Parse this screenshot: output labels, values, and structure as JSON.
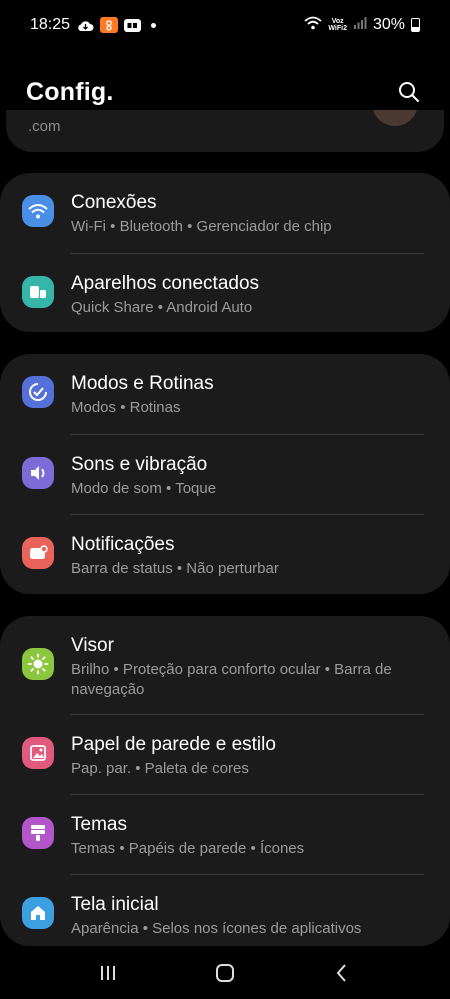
{
  "status_bar": {
    "time": "18:25",
    "voz_line1": "Voz",
    "voz_line2": "WiFi2",
    "battery": "30%",
    "icons": [
      "cloud-icon",
      "orange-app-icon",
      "box-app-icon",
      "notification-dot-icon",
      "wifi-icon",
      "signal-icon",
      "battery-icon"
    ]
  },
  "header": {
    "title": "Config.",
    "search_icon": "search-icon"
  },
  "account": {
    "email_fragment": ".com"
  },
  "groups": [
    {
      "items": [
        {
          "title": "Conexões",
          "subtitle": "Wi-Fi  •  Bluetooth  •  Gerenciador de chip",
          "icon": "wifi-icon",
          "color": "#4a8fe6"
        },
        {
          "title": "Aparelhos conectados",
          "subtitle": "Quick Share  •  Android Auto",
          "icon": "devices-icon",
          "color": "#35b6a8"
        }
      ]
    },
    {
      "items": [
        {
          "title": "Modos e Rotinas",
          "subtitle": "Modos  •  Rotinas",
          "icon": "modes-icon",
          "color": "#5570d8"
        },
        {
          "title": "Sons e vibração",
          "subtitle": "Modo de som  •  Toque",
          "icon": "sound-icon",
          "color": "#7d6bd8"
        },
        {
          "title": "Notificações",
          "subtitle": "Barra de status  •  Não perturbar",
          "icon": "notification-icon",
          "color": "#e8645a"
        }
      ]
    },
    {
      "items": [
        {
          "title": "Visor",
          "subtitle": "Brilho  •  Proteção para conforto ocular  •  Barra de navegação",
          "icon": "brightness-icon",
          "color": "#8cc63f"
        },
        {
          "title": "Papel de parede e estilo",
          "subtitle": "Pap. par.  •  Paleta de cores",
          "icon": "wallpaper-icon",
          "color": "#e05a7e"
        },
        {
          "title": "Temas",
          "subtitle": "Temas  •  Papéis de parede  •  Ícones",
          "icon": "themes-icon",
          "color": "#b356c9"
        },
        {
          "title": "Tela inicial",
          "subtitle": "Aparência  •  Selos nos ícones de aplicativos",
          "icon": "home-icon",
          "color": "#3c9fe0"
        }
      ]
    }
  ],
  "nav_bar": {
    "buttons": [
      "recents-icon",
      "home-button-icon",
      "back-icon"
    ]
  },
  "colors": {
    "background": "#000000",
    "card": "#1b1b1b",
    "subtitle": "#9b9b9b"
  }
}
